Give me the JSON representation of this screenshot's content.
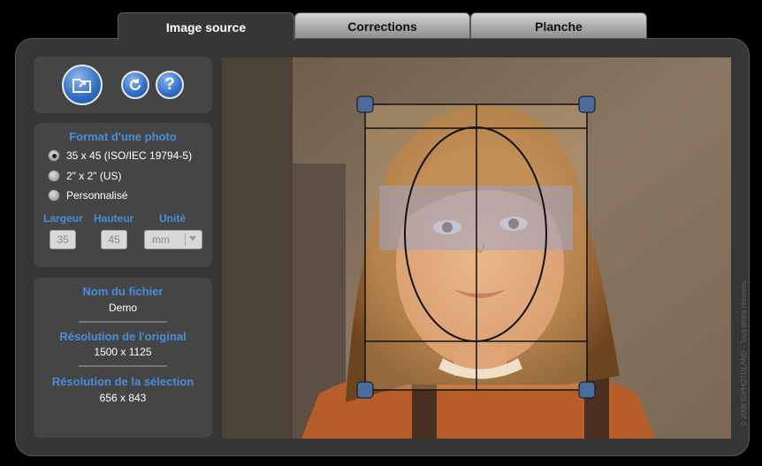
{
  "tabs": [
    {
      "label": "Image source",
      "active": true
    },
    {
      "label": "Corrections",
      "active": false
    },
    {
      "label": "Planche",
      "active": false
    }
  ],
  "format": {
    "title": "Format d'une photo",
    "options": [
      {
        "label": "35 x 45 (ISO/IEC 19794-5)",
        "selected": true
      },
      {
        "label": "2\" x 2\" (US)",
        "selected": false
      },
      {
        "label": "Personnalisé",
        "selected": false
      }
    ],
    "width_label": "Largeur",
    "height_label": "Hauteur",
    "unit_label": "Unité",
    "width_value": "35",
    "height_value": "45",
    "unit_value": "mm"
  },
  "info": {
    "filename_title": "Nom du fichier",
    "filename": "Demo",
    "orig_res_title": "Résolution de l'original",
    "orig_res": "1500 x 1125",
    "sel_res_title": "Résolution de la sélection",
    "sel_res": "656 x 843"
  },
  "copyright": "© 2008 IDPHOTOLAND - Tous droits réservés",
  "icons": {
    "open": "open-folder-icon",
    "rotate": "rotate-icon",
    "help": "help-icon"
  },
  "colors": {
    "accent": "#4a8ddb",
    "handle": "#4b6d9e",
    "background": "#363636"
  }
}
